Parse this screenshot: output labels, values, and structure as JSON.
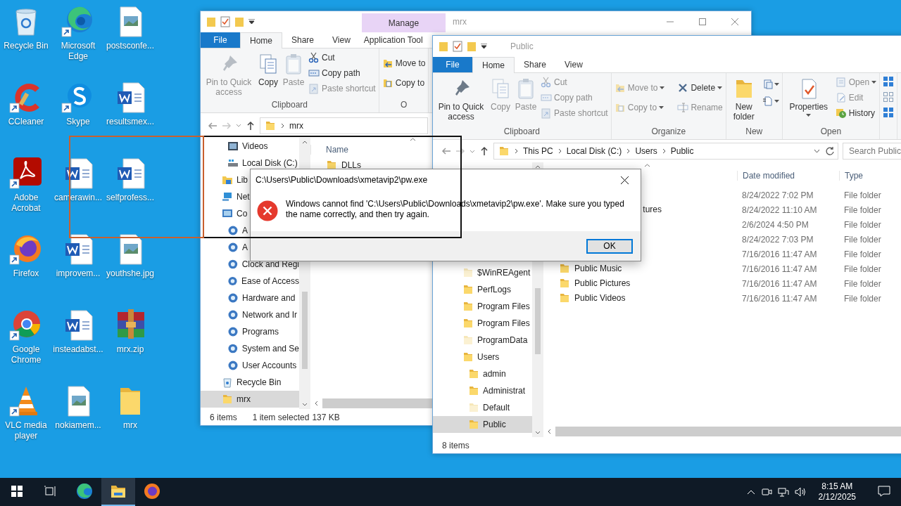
{
  "desktop": {
    "icons": [
      {
        "label": "Recycle Bin",
        "kind": "recycle_bin",
        "shortcut": false
      },
      {
        "label": "Microsoft Edge",
        "kind": "edge",
        "shortcut": true
      },
      {
        "label": "postsconfe...",
        "kind": "image_file",
        "shortcut": false
      },
      {
        "label": "CCleaner",
        "kind": "ccleaner",
        "shortcut": true
      },
      {
        "label": "Skype",
        "kind": "skype",
        "shortcut": true
      },
      {
        "label": "resultsmex...",
        "kind": "word_doc",
        "shortcut": false
      },
      {
        "label": "Adobe Acrobat",
        "kind": "acrobat",
        "shortcut": true
      },
      {
        "label": "camerawin...",
        "kind": "word_doc",
        "shortcut": false
      },
      {
        "label": "selfprofess...",
        "kind": "word_doc",
        "shortcut": false
      },
      {
        "label": "Firefox",
        "kind": "firefox",
        "shortcut": true
      },
      {
        "label": "improvem...",
        "kind": "word_doc",
        "shortcut": false
      },
      {
        "label": "youthshe.jpg",
        "kind": "image_file",
        "shortcut": false
      },
      {
        "label": "Google Chrome",
        "kind": "chrome",
        "shortcut": true
      },
      {
        "label": "insteadabst...",
        "kind": "word_doc",
        "shortcut": false
      },
      {
        "label": "mrx.zip",
        "kind": "archive",
        "shortcut": false
      },
      {
        "label": "VLC media player",
        "kind": "vlc",
        "shortcut": true
      },
      {
        "label": "nokiamem...",
        "kind": "image_file",
        "shortcut": false
      },
      {
        "label": "mrx",
        "kind": "folder",
        "shortcut": false
      }
    ]
  },
  "mrx_window": {
    "title": "mrx",
    "contextual_tab": "Manage",
    "tabs": [
      {
        "label": "File",
        "kind": "file",
        "selected": false
      },
      {
        "label": "Home",
        "kind": "tab",
        "selected": true
      },
      {
        "label": "Share",
        "kind": "tab",
        "selected": false
      },
      {
        "label": "View",
        "kind": "tab",
        "selected": false
      },
      {
        "label": "Application Tool",
        "kind": "contextual",
        "selected": false
      }
    ],
    "ribbon": {
      "clipboard": {
        "label": "Clipboard",
        "pin": {
          "label": "Pin to Quick access",
          "disabled": true
        },
        "copy": {
          "label": "Copy",
          "disabled": false
        },
        "paste": {
          "label": "Paste",
          "disabled": true
        },
        "cut": {
          "label": "Cut",
          "disabled": false
        },
        "copy_path": {
          "label": "Copy path",
          "disabled": false
        },
        "paste_shortcut": {
          "label": "Paste shortcut",
          "disabled": true
        }
      },
      "organize": {
        "label": "O",
        "move_to": {
          "label": "Move to",
          "disabled": false
        },
        "copy_to": {
          "label": "Copy to",
          "disabled": false
        }
      }
    },
    "address": [
      "mrx"
    ],
    "nav": [
      {
        "children": [
          {
            "label": "Videos",
            "kind": "videos",
            "selected": false
          },
          {
            "label": "Local Disk (C:)",
            "kind": "drive",
            "selected": false
          }
        ]
      },
      {
        "label": "Lib",
        "kind": "library",
        "selected": false
      },
      {
        "label": "Net",
        "kind": "network",
        "selected": false
      },
      {
        "label": "Co",
        "kind": "control_panel",
        "selected": false,
        "children": [
          {
            "label": "A",
            "kind": "applet",
            "selected": false
          },
          {
            "label": "A",
            "kind": "applet",
            "selected": false
          },
          {
            "label": "Clock and Regi",
            "kind": "applet",
            "selected": false
          },
          {
            "label": "Ease of Access",
            "kind": "applet",
            "selected": false
          },
          {
            "label": "Hardware and",
            "kind": "applet",
            "selected": false
          },
          {
            "label": "Network and Ir",
            "kind": "applet",
            "selected": false
          },
          {
            "label": "Programs",
            "kind": "applet",
            "selected": false
          },
          {
            "label": "System and Se",
            "kind": "applet",
            "selected": false
          },
          {
            "label": "User Accounts",
            "kind": "applet",
            "selected": false
          }
        ]
      },
      {
        "label": "Recycle Bin",
        "kind": "recycle_bin",
        "selected": false
      },
      {
        "label": "mrx",
        "kind": "folder",
        "selected": true
      }
    ],
    "columns": [
      "Name"
    ],
    "rows": [
      {
        "name": "DLLs",
        "kind": "folder"
      }
    ],
    "status": {
      "items": "6 items",
      "selection": "1 item selected",
      "size": "137 KB"
    }
  },
  "public_window": {
    "title": "Public",
    "tabs": [
      {
        "label": "File",
        "kind": "file",
        "selected": false
      },
      {
        "label": "Home",
        "kind": "tab",
        "selected": true
      },
      {
        "label": "Share",
        "kind": "tab",
        "selected": false
      },
      {
        "label": "View",
        "kind": "tab",
        "selected": false
      }
    ],
    "ribbon": {
      "clipboard": {
        "label": "Clipboard",
        "pin": {
          "label": "Pin to Quick access",
          "disabled": false
        },
        "copy": {
          "label": "Copy",
          "disabled": true
        },
        "paste": {
          "label": "Paste",
          "disabled": true
        },
        "cut": {
          "label": "Cut",
          "disabled": true
        },
        "copy_path": {
          "label": "Copy path",
          "disabled": true
        },
        "paste_shortcut": {
          "label": "Paste shortcut",
          "disabled": true
        }
      },
      "organize": {
        "label": "Organize",
        "move_to": {
          "label": "Move to",
          "disabled": true
        },
        "copy_to": {
          "label": "Copy to",
          "disabled": true
        },
        "delete": {
          "label": "Delete",
          "disabled": false
        },
        "rename": {
          "label": "Rename",
          "disabled": true
        }
      },
      "new": {
        "label": "New",
        "new_folder": {
          "label": "New folder",
          "disabled": false
        }
      },
      "open": {
        "label": "Open",
        "properties": {
          "label": "Properties",
          "disabled": false
        },
        "open": {
          "label": "Open",
          "disabled": true
        },
        "edit": {
          "label": "Edit",
          "disabled": true
        },
        "history": {
          "label": "History",
          "disabled": false
        }
      }
    },
    "address": [
      "This PC",
      "Local Disk (C:)",
      "Users",
      "Public"
    ],
    "search": {
      "placeholder": "Search Public"
    },
    "nav": [
      {
        "children": [
          {
            "label": "$WinREAgent",
            "kind": "folder",
            "hidden": true,
            "selected": false
          },
          {
            "label": "PerfLogs",
            "kind": "folder",
            "hidden": false,
            "selected": false
          },
          {
            "label": "Program Files",
            "kind": "folder",
            "hidden": false,
            "selected": false
          },
          {
            "label": "Program Files",
            "kind": "folder",
            "hidden": false,
            "selected": false
          },
          {
            "label": "ProgramData",
            "kind": "folder",
            "hidden": true,
            "selected": false
          },
          {
            "label": "Users",
            "kind": "folder",
            "hidden": false,
            "selected": false,
            "children": [
              {
                "label": "admin",
                "kind": "folder",
                "hidden": false,
                "selected": false
              },
              {
                "label": "Administrat",
                "kind": "folder",
                "hidden": false,
                "selected": false
              },
              {
                "label": "Default",
                "kind": "folder",
                "hidden": true,
                "selected": false
              },
              {
                "label": "Public",
                "kind": "folder",
                "hidden": false,
                "selected": true
              }
            ]
          }
        ]
      }
    ],
    "columns": [
      "Date modified",
      "Type"
    ],
    "rows": [
      {
        "kind": "covered",
        "date": "8/24/2022 7:02 PM",
        "type": "File folder"
      },
      {
        "kind": "partial",
        "name": "tures",
        "date": "8/24/2022 11:10 AM",
        "type": "File folder"
      },
      {
        "kind": "covered",
        "date": "2/6/2024 4:50 PM",
        "type": "File folder"
      },
      {
        "kind": "covered",
        "date": "8/24/2022 7:03 PM",
        "type": "File folder"
      },
      {
        "kind": "covered",
        "date": "7/16/2016 11:47 AM",
        "type": "File folder"
      },
      {
        "kind": "folder",
        "name": "Public Music",
        "date": "7/16/2016 11:47 AM",
        "type": "File folder"
      },
      {
        "kind": "folder",
        "name": "Public Pictures",
        "date": "7/16/2016 11:47 AM",
        "type": "File folder"
      },
      {
        "kind": "folder",
        "name": "Public Videos",
        "date": "7/16/2016 11:47 AM",
        "type": "File folder"
      }
    ],
    "status": {
      "items": "8 items"
    }
  },
  "dialog": {
    "title": "C:\\Users\\Public\\Downloads\\xmetavip2\\pw.exe",
    "message": "Windows cannot find 'C:\\Users\\Public\\Downloads\\xmetavip2\\pw.exe'. Make sure you typed the name correctly, and then try again.",
    "button": "OK"
  },
  "taskbar": {
    "apps": [
      {
        "kind": "edge",
        "active": false
      },
      {
        "kind": "explorer",
        "active": true
      },
      {
        "kind": "firefox",
        "active": false
      }
    ],
    "clock": {
      "time": "8:15 AM",
      "date": "2/12/2025"
    }
  }
}
